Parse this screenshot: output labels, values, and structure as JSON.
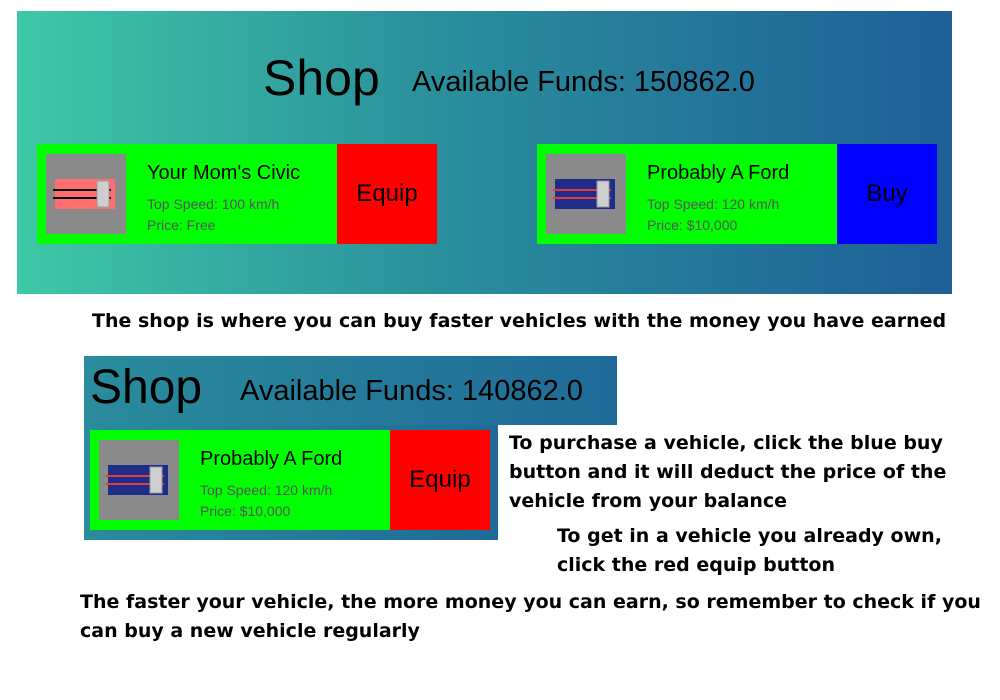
{
  "top_panel": {
    "title": "Shop",
    "funds": "Available Funds: 150862.0",
    "cards": [
      {
        "name": "Your Mom's Civic",
        "speed": "Top Speed: 100 km/h",
        "price": "Price: Free",
        "action": "Equip",
        "car_color": "#ff6f6f"
      },
      {
        "name": "Probably A Ford",
        "speed": "Top Speed: 120 km/h",
        "price": "Price: $10,000",
        "action": "Buy",
        "car_color": "#1f2d8a"
      }
    ]
  },
  "caption_shop": "The shop is where you can buy faster vehicles with the money you have earned",
  "small_panel": {
    "title": "Shop",
    "funds": "Available Funds: 140862.0",
    "card": {
      "name": "Probably A Ford",
      "speed": "Top Speed: 120 km/h",
      "price": "Price: $10,000",
      "action": "Equip",
      "car_color": "#1f2d8a"
    }
  },
  "note_purchase": [
    "To purchase a vehicle, click the blue buy",
    "button and it will deduct the price of the",
    "vehicle from your balance"
  ],
  "note_equip": [
    "To get in a vehicle you already own,",
    "click the red equip button"
  ],
  "note_faster": [
    "The faster your vehicle, the more money you can earn, so remember to check if you",
    "can buy a new vehicle regularly"
  ],
  "colors": {
    "card_bg": "#00ff00",
    "equip": "#ff0000",
    "buy": "#0000ff"
  }
}
